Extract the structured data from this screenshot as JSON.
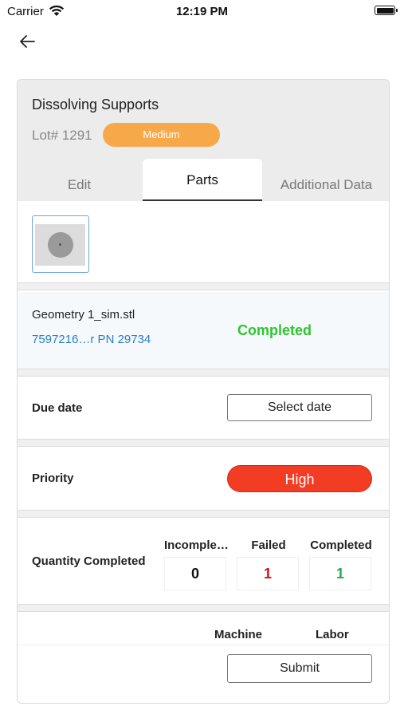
{
  "status_bar": {
    "carrier": "Carrier",
    "time": "12:19 PM"
  },
  "header": {
    "title": "Dissolving Supports",
    "lot": "Lot# 1291",
    "badge": "Medium",
    "badge_color": "#f7a94a"
  },
  "tabs": [
    {
      "label": "Edit",
      "active": false
    },
    {
      "label": "Parts",
      "active": true
    },
    {
      "label": "Additional Data",
      "active": false
    }
  ],
  "part": {
    "name": "Geometry 1_sim.stl",
    "link": "7597216…r PN 29734",
    "status": "Completed",
    "status_color": "#2fc52f"
  },
  "due_date": {
    "label": "Due date",
    "button": "Select date"
  },
  "priority": {
    "label": "Priority",
    "value": "High",
    "color": "#f23d24"
  },
  "quantity": {
    "label": "Quantity Completed",
    "columns": [
      {
        "header": "Incomple…",
        "value": "0",
        "color": "#111111"
      },
      {
        "header": "Failed",
        "value": "1",
        "color": "#d0121b"
      },
      {
        "header": "Completed",
        "value": "1",
        "color": "#1bb04a"
      }
    ]
  },
  "times": {
    "machine": "Machine",
    "labor": "Labor"
  },
  "submit": "Submit"
}
